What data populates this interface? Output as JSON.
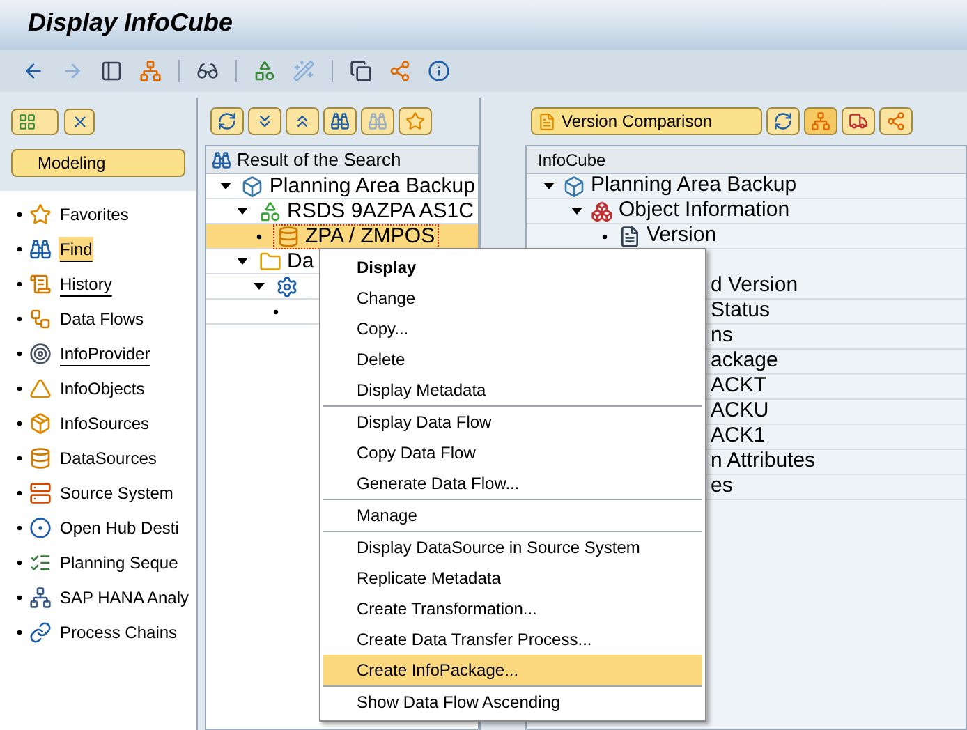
{
  "window": {
    "title": "Display InfoCube"
  },
  "left_panel": {
    "button": "Modeling",
    "items": [
      {
        "label": "Favorites",
        "selected": false,
        "underlined": false
      },
      {
        "label": "Find",
        "selected": true,
        "underlined": true
      },
      {
        "label": "History",
        "selected": false,
        "underlined": true
      },
      {
        "label": "Data Flows",
        "selected": false,
        "underlined": false
      },
      {
        "label": "InfoProvider",
        "selected": false,
        "underlined": true
      },
      {
        "label": "InfoObjects",
        "selected": false,
        "underlined": false
      },
      {
        "label": "InfoSources",
        "selected": false,
        "underlined": false
      },
      {
        "label": "DataSources",
        "selected": false,
        "underlined": false
      },
      {
        "label": "Source System",
        "selected": false,
        "underlined": false
      },
      {
        "label": "Open Hub Desti",
        "selected": false,
        "underlined": false
      },
      {
        "label": "Planning Seque",
        "selected": false,
        "underlined": false
      },
      {
        "label": "SAP HANA Analy",
        "selected": false,
        "underlined": false
      },
      {
        "label": "Process Chains",
        "selected": false,
        "underlined": false
      }
    ]
  },
  "middle_panel": {
    "header": "Result of the Search",
    "tree": [
      {
        "label": "Planning Area Backup",
        "kind": "cube",
        "expanded": true,
        "selected": false,
        "children": [
          {
            "label": "RSDS 9AZPA AS1C",
            "kind": "transformation",
            "expanded": true,
            "selected": false,
            "children": [
              {
                "label": "ZPA / ZMPOS",
                "kind": "datasource",
                "selected": true
              }
            ]
          },
          {
            "label": "Da",
            "kind": "folder",
            "expanded": true,
            "selected": false,
            "children": [
              {
                "kind": "gear",
                "expanded": true,
                "selected": false,
                "children": [
                  {
                    "selected": false
                  }
                ]
              }
            ]
          }
        ]
      }
    ]
  },
  "right_panel": {
    "dropdown": "Version Comparison",
    "header": "InfoCube",
    "tree": [
      {
        "label": "Planning Area Backup",
        "kind": "cube",
        "children": [
          {
            "label": "Object Information",
            "kind": "info",
            "children": [
              {
                "label": "Version",
                "kind": "document"
              }
            ]
          }
        ]
      }
    ],
    "covered_rows": [
      "d Version",
      "Status",
      "ns",
      "ackage",
      "ACKT",
      "ACKU",
      "ACK1",
      "n Attributes",
      "es"
    ]
  },
  "context_menu": {
    "groups": [
      [
        {
          "label": "Display",
          "default": true,
          "selected": false
        },
        {
          "label": "Change",
          "default": false,
          "selected": false
        },
        {
          "label": "Copy...",
          "default": false,
          "selected": false
        },
        {
          "label": "Delete",
          "default": false,
          "selected": false
        },
        {
          "label": "Display Metadata",
          "default": false,
          "selected": false
        }
      ],
      [
        {
          "label": "Display Data Flow",
          "default": false,
          "selected": false
        },
        {
          "label": "Copy Data Flow",
          "default": false,
          "selected": false
        },
        {
          "label": "Generate Data Flow...",
          "default": false,
          "selected": false
        }
      ],
      [
        {
          "label": "Manage",
          "default": false,
          "selected": false
        }
      ],
      [
        {
          "label": "Display DataSource in Source System",
          "default": false,
          "selected": false
        },
        {
          "label": "Replicate Metadata",
          "default": false,
          "selected": false
        },
        {
          "label": "Create Transformation...",
          "default": false,
          "selected": false
        },
        {
          "label": "Create Data Transfer Process...",
          "default": false,
          "selected": false
        },
        {
          "label": "Create InfoPackage...",
          "default": false,
          "selected": true
        }
      ],
      [
        {
          "label": "Show Data Flow Ascending",
          "default": false,
          "selected": false
        }
      ]
    ]
  }
}
